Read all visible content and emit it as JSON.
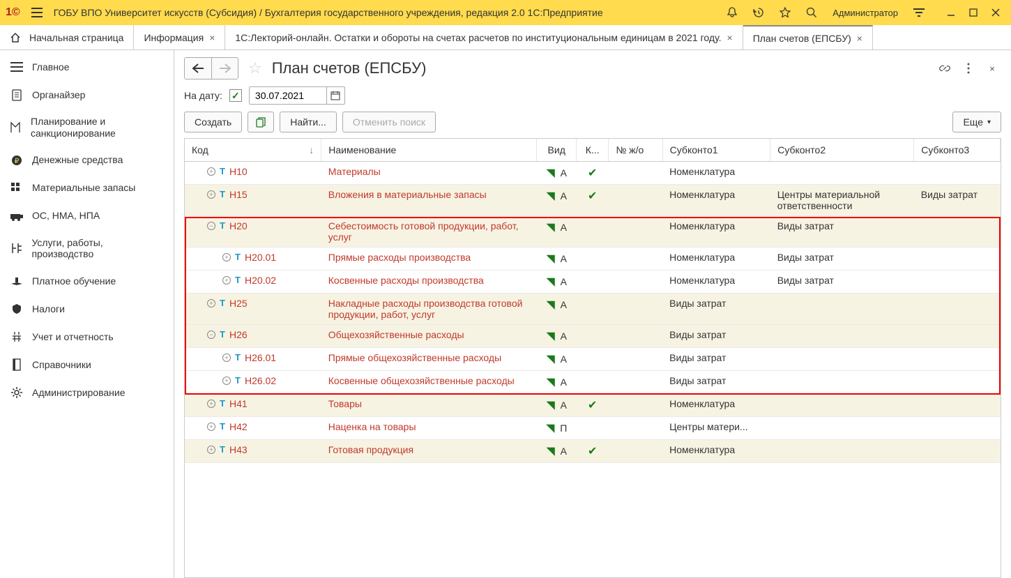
{
  "titlebar": {
    "title": "ГОБУ ВПО Университет искусств (Субсидия) / Бухгалтерия государственного учреждения, редакция 2.0 1С:Предприятие",
    "username": "Администратор"
  },
  "tabs": {
    "home": "Начальная страница",
    "t1": "Информация",
    "t2": "1С:Лекторий-онлайн. Остатки и обороты на счетах расчетов по институциональным единицам в 2021 году.",
    "t3": "План счетов (ЕПСБУ)"
  },
  "sidebar": {
    "items": [
      {
        "label": "Главное"
      },
      {
        "label": "Органайзер"
      },
      {
        "label": "Планирование и санкционирование"
      },
      {
        "label": "Денежные средства"
      },
      {
        "label": "Материальные запасы"
      },
      {
        "label": "ОС, НМА, НПА"
      },
      {
        "label": "Услуги, работы, производство"
      },
      {
        "label": "Платное обучение"
      },
      {
        "label": "Налоги"
      },
      {
        "label": "Учет и отчетность"
      },
      {
        "label": "Справочники"
      },
      {
        "label": "Администрирование"
      }
    ]
  },
  "form": {
    "title": "План счетов (ЕПСБУ)",
    "date_label": "На дату:",
    "date_value": "30.07.2021",
    "buttons": {
      "create": "Создать",
      "find": "Найти...",
      "cancel_find": "Отменить поиск",
      "more": "Еще"
    }
  },
  "columns": {
    "code": "Код",
    "name": "Наименование",
    "vid": "Вид",
    "k": "К...",
    "zo": "№ ж/о",
    "s1": "Субконто1",
    "s2": "Субконто2",
    "s3": "Субконто3"
  },
  "rows": [
    {
      "lvl": 0,
      "exp": "plus",
      "code": "Н10",
      "name": "Материалы",
      "vid": "А",
      "k": true,
      "s1": "Номенклатура",
      "s2": "",
      "s3": "",
      "hl": false,
      "cls": "odd"
    },
    {
      "lvl": 0,
      "exp": "plus",
      "code": "Н15",
      "name": "Вложения в материальные запасы",
      "vid": "А",
      "k": true,
      "s1": "Номенклатура",
      "s2": "Центры материальной ответственности",
      "s3": "Виды затрат",
      "hl": false,
      "cls": "even"
    },
    {
      "lvl": 0,
      "exp": "minus",
      "code": "Н20",
      "name": "Себестоимость готовой продукции, работ, услуг",
      "vid": "А",
      "k": false,
      "s1": "Номенклатура",
      "s2": "Виды затрат",
      "s3": "",
      "hl": true,
      "cls": "even"
    },
    {
      "lvl": 1,
      "exp": "plus",
      "code": "Н20.01",
      "name": "Прямые расходы производства",
      "vid": "А",
      "k": false,
      "s1": "Номенклатура",
      "s2": "Виды затрат",
      "s3": "",
      "hl": true,
      "cls": "odd"
    },
    {
      "lvl": 1,
      "exp": "plus",
      "code": "Н20.02",
      "name": "Косвенные расходы производства",
      "vid": "А",
      "k": false,
      "s1": "Номенклатура",
      "s2": "Виды затрат",
      "s3": "",
      "hl": true,
      "cls": "odd"
    },
    {
      "lvl": 0,
      "exp": "plus",
      "code": "Н25",
      "name": "Накладные расходы производства готовой продукции, работ, услуг",
      "vid": "А",
      "k": false,
      "s1": "Виды затрат",
      "s2": "",
      "s3": "",
      "hl": true,
      "cls": "even"
    },
    {
      "lvl": 0,
      "exp": "minus",
      "code": "Н26",
      "name": "Общехозяйственные расходы",
      "vid": "А",
      "k": false,
      "s1": "Виды затрат",
      "s2": "",
      "s3": "",
      "hl": true,
      "cls": "even"
    },
    {
      "lvl": 1,
      "exp": "plus",
      "code": "Н26.01",
      "name": "Прямые общехозяйственные расходы",
      "vid": "А",
      "k": false,
      "s1": "Виды затрат",
      "s2": "",
      "s3": "",
      "hl": true,
      "cls": "odd"
    },
    {
      "lvl": 1,
      "exp": "plus",
      "code": "Н26.02",
      "name": "Косвенные общехозяйственные расходы",
      "vid": "А",
      "k": false,
      "s1": "Виды затрат",
      "s2": "",
      "s3": "",
      "hl": true,
      "cls": "odd"
    },
    {
      "lvl": 0,
      "exp": "plus",
      "code": "Н41",
      "name": "Товары",
      "vid": "А",
      "k": true,
      "s1": "Номенклатура",
      "s2": "",
      "s3": "",
      "hl": false,
      "cls": "even"
    },
    {
      "lvl": 0,
      "exp": "plus",
      "code": "Н42",
      "name": "Наценка на товары",
      "vid": "П",
      "k": false,
      "s1": "Центры матери...",
      "s2": "",
      "s3": "",
      "hl": false,
      "cls": "odd"
    },
    {
      "lvl": 0,
      "exp": "plus",
      "code": "Н43",
      "name": "Готовая продукция",
      "vid": "А",
      "k": true,
      "s1": "Номенклатура",
      "s2": "",
      "s3": "",
      "hl": false,
      "cls": "even"
    }
  ]
}
